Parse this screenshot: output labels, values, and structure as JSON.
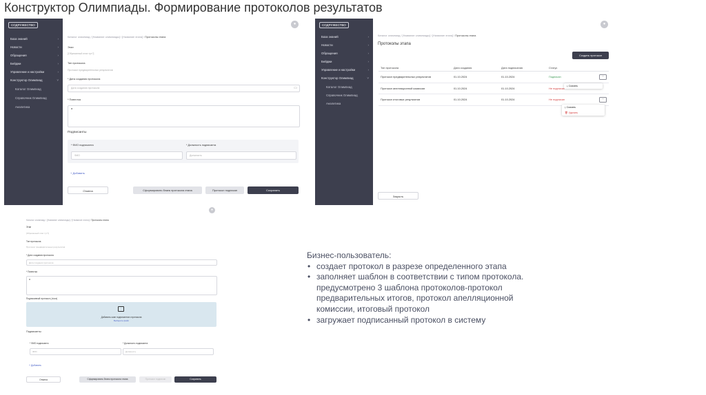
{
  "title": "Конструктор Олимпиады. Формирование протоколов результатов",
  "sidebar": {
    "logo": "СОДРУЖЕСТВО",
    "items": [
      "База знаний",
      "Новости",
      "Обращения",
      "Бейджи",
      "Управление и настройки",
      "Конструктор Олимпиад"
    ],
    "subitems": [
      "Каталог Олимпиад",
      "Справочник Олимпиад",
      "Аналитика"
    ]
  },
  "form": {
    "breadcrumbs": [
      "Каталог олимпиад",
      "[Название олимпиады]",
      "[Название этапа]"
    ],
    "breadcrumb_current": "Протоколы этапа",
    "stage_label": "Этап",
    "stage_value": "[Обрезанный этап тут?]",
    "type_label": "Тип протокола",
    "type_value": "Протокол предварительных результатов",
    "date_label": "Дата создания протокола",
    "date_placeholder": "Дата создания протокола",
    "agenda_label": "Повестка",
    "agenda_value": "a",
    "signed_label": "Подписанный протокол (.docx)",
    "upload_text": "Добавить скан подписанного протокола",
    "upload_link": "Выберите файл",
    "signers_title": "Подписанты",
    "signer_name_label": "ФИО подписанта",
    "signer_name_placeholder": "ФИО",
    "signer_pos_label": "Должность подписанта",
    "signer_pos_placeholder": "Должность",
    "add_label": "Добавить",
    "cancel": "Отмена",
    "generate": "Сформировать бланк протокола этапа",
    "signed_btn": "Протокол подписан",
    "save": "Сохранить"
  },
  "protocols": {
    "breadcrumbs": [
      "Каталог олимпиад",
      "[Название олимпиады]",
      "[Название этапа]"
    ],
    "breadcrumb_current": "Протоколы этапа",
    "page_title": "Протоколы этапа",
    "create_button": "Создать протокол",
    "columns": [
      "Тип протокола",
      "Дата создания",
      "Дата подписания",
      "Статус"
    ],
    "rows": [
      {
        "type": "Протокол предварительных результатов",
        "created": "01.10.2024",
        "signed": "01.10.2024",
        "status": "Подписан"
      },
      {
        "type": "Протокол апелляционной комиссии",
        "created": "01.10.2024",
        "signed": "01.10.2024",
        "status": "Не подписан"
      },
      {
        "type": "Протокол итоговых результатов",
        "created": "01.10.2024",
        "signed": "01.10.2024",
        "status": "Не подписан"
      }
    ],
    "menu1": [
      "Скачать"
    ],
    "menu2": [
      "Скачать",
      "Удалить"
    ],
    "close_button": "Закрыть"
  },
  "business": {
    "heading": "Бизнес-пользователь:",
    "bullets": [
      "создает протокол в разрезе определенного этапа",
      "заполняет шаблон в соответствии с типом протокола. предусмотрено 3 шаблона протоколов-протокол предварительных итогов, протокол апелляционной комиссии, итоговый протокол",
      "загружает подписанный протокол в систему"
    ]
  },
  "colors": {
    "sidebar": "#3d3f4e",
    "accent": "#4a62c8",
    "upload": "#d9e7ef",
    "signed": "#3f9b57",
    "unsigned": "#d64545"
  }
}
